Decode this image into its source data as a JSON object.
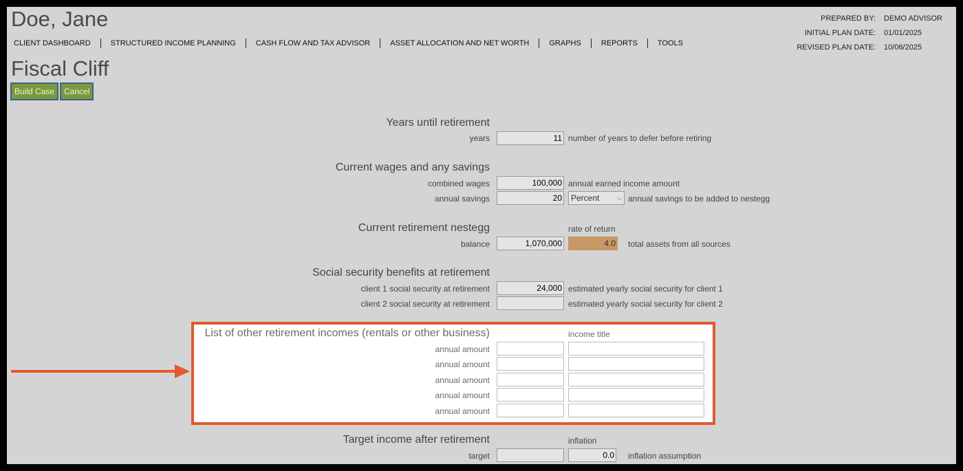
{
  "client": {
    "name": "Doe, Jane"
  },
  "prepared": {
    "prepared_by_label": "PREPARED BY:",
    "prepared_by": "DEMO ADVISOR",
    "initial_label": "INITIAL PLAN DATE:",
    "initial_date": "01/01/2025",
    "revised_label": "REVISED PLAN DATE:",
    "revised_date": "10/06/2025"
  },
  "nav": [
    "CLIENT DASHBOARD",
    "STRUCTURED INCOME PLANNING",
    "CASH FLOW AND TAX ADVISOR",
    "ASSET ALLOCATION AND NET WORTH",
    "GRAPHS",
    "REPORTS",
    "TOOLS"
  ],
  "page": {
    "title": "Fiscal Cliff",
    "build_case": "Build Case",
    "cancel": "Cancel"
  },
  "years": {
    "heading": "Years until retirement",
    "label": "years",
    "value": "11",
    "hint": "number of years to defer before retiring"
  },
  "wages": {
    "heading": "Current wages and any savings",
    "wages_label": "combined wages",
    "wages_value": "100,000",
    "wages_hint": "annual earned income amount",
    "savings_label": "annual savings",
    "savings_value": "20",
    "savings_unit": "Percent",
    "savings_hint": "annual savings to be added to nestegg"
  },
  "nestegg": {
    "heading": "Current retirement nestegg",
    "rate_label": "rate of return",
    "balance_label": "balance",
    "balance_value": "1,070,000",
    "rate_value": "4.0",
    "hint": "total assets from all sources"
  },
  "social": {
    "heading": "Social security benefits at retirement",
    "c1_label": "client 1 social security at retirement",
    "c1_value": "24,000",
    "c1_hint": "estimated yearly social security for client 1",
    "c2_label": "client 2 social security at retirement",
    "c2_value": "",
    "c2_hint": "estimated yearly social security for client 2"
  },
  "other_income": {
    "heading": "List of other retirement incomes (rentals or other business)",
    "title_label": "income title",
    "rows": [
      "annual amount",
      "annual amount",
      "annual amount",
      "annual amount",
      "annual amount"
    ]
  },
  "target": {
    "heading": "Target income after retirement",
    "inflation_label": "inflation",
    "target_label": "target",
    "target_value": "",
    "inflation_value": "0.0",
    "hint": "inflation assumption"
  },
  "colors": {
    "highlight": "#e05a2d",
    "button": "#7a9a3a",
    "rate": "#c79766"
  }
}
